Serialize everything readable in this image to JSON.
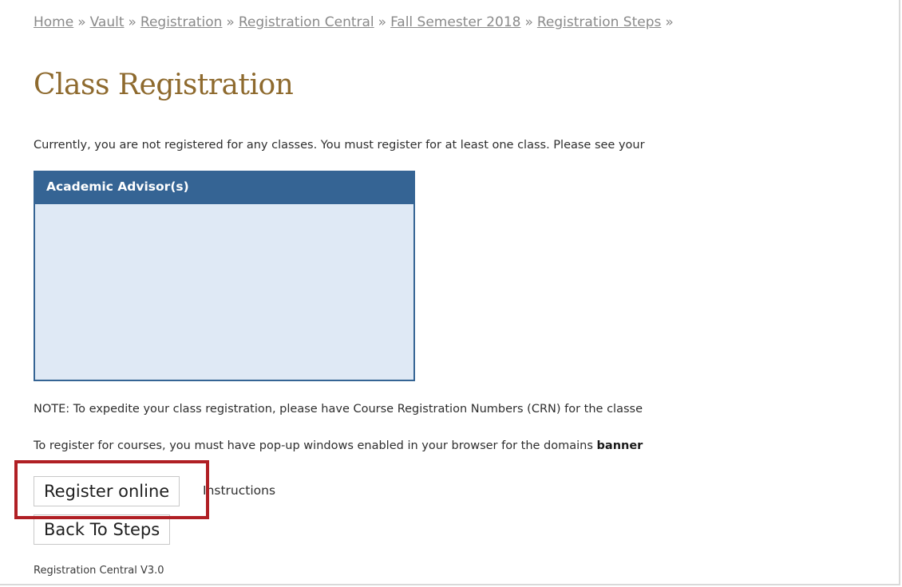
{
  "breadcrumb": {
    "items": [
      "Home",
      "Vault",
      "Registration",
      "Registration Central",
      "Fall Semester 2018",
      "Registration Steps"
    ],
    "separator": "»"
  },
  "page": {
    "title": "Class Registration",
    "intro": "Currently, you are not registered for any classes. You must register for at least one class. Please see your",
    "note": "NOTE: To expedite your class registration, please have Course Registration Numbers (CRN) for the classe",
    "popup_text": "To register for courses, you must have pop-up windows enabled in your browser for the domains ",
    "popup_bold": "banner",
    "version": "Registration Central V3.0"
  },
  "advisor": {
    "header": "Academic Advisor(s)"
  },
  "actions": {
    "register_label": "Register online",
    "instructions_label": "Instructions",
    "back_label": "Back To Steps"
  },
  "colors": {
    "title": "#8e6a2e",
    "advisor_header_bg": "#356494",
    "advisor_body_bg": "#dfe9f5",
    "highlight": "#b01f24"
  }
}
